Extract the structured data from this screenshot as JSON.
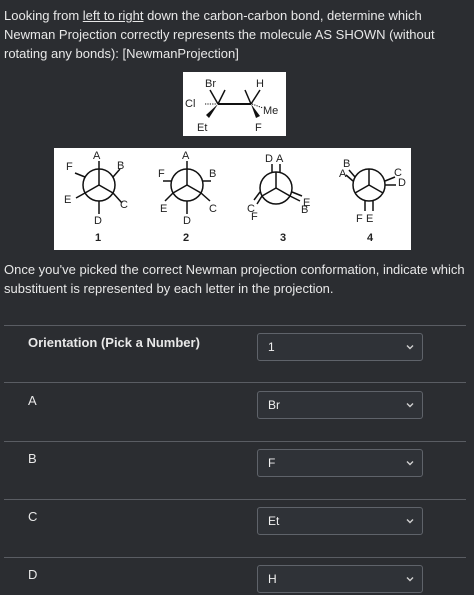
{
  "question": {
    "p1": "Looking from ",
    "underlined": "left to right",
    "p2": " down the carbon-carbon bond, determine which Newman Projection correctly represents the molecule AS SHOWN (without rotating any bonds): [NewmanProjection]"
  },
  "molecule": {
    "top_left": "Br",
    "top_right": "H",
    "left": "Cl",
    "bottom_left": "Et",
    "right": "Me",
    "bottom_right": "F"
  },
  "projections": [
    {
      "number": "1",
      "labels": [
        "A",
        "B",
        "C",
        "D",
        "E",
        "F"
      ]
    },
    {
      "number": "2",
      "labels": [
        "A",
        "B",
        "C",
        "D",
        "E",
        "F"
      ]
    },
    {
      "number": "3",
      "labels": [
        "D",
        "A",
        "E",
        "B",
        "C",
        "F"
      ]
    },
    {
      "number": "4",
      "labels": [
        "B",
        "A",
        "C",
        "D",
        "F",
        "E"
      ]
    }
  ],
  "prompt": "Once you've picked the correct Newman projection conformation, indicate which substituent is represented by each letter in the projection.",
  "table": {
    "header_label": "Orientation (Pick a Number)",
    "header_value": "1",
    "rows": [
      {
        "label": "A",
        "value": "Br"
      },
      {
        "label": "B",
        "value": "F"
      },
      {
        "label": "C",
        "value": "Et"
      },
      {
        "label": "D",
        "value": "H"
      }
    ]
  },
  "icons": {
    "dropdown": "chevron-down-icon"
  }
}
